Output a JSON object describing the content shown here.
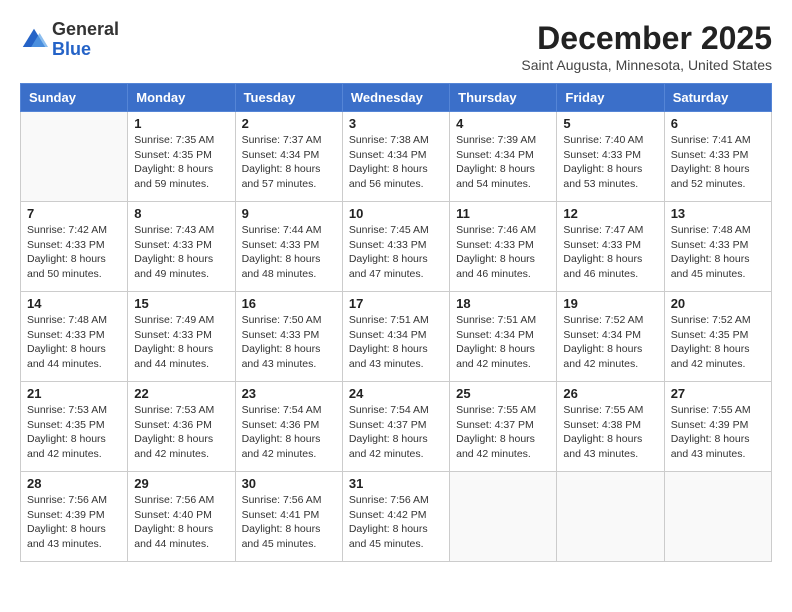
{
  "logo": {
    "general": "General",
    "blue": "Blue"
  },
  "title": "December 2025",
  "location": "Saint Augusta, Minnesota, United States",
  "days_header": [
    "Sunday",
    "Monday",
    "Tuesday",
    "Wednesday",
    "Thursday",
    "Friday",
    "Saturday"
  ],
  "weeks": [
    [
      {
        "day": "",
        "info": ""
      },
      {
        "day": "1",
        "info": "Sunrise: 7:35 AM\nSunset: 4:35 PM\nDaylight: 8 hours\nand 59 minutes."
      },
      {
        "day": "2",
        "info": "Sunrise: 7:37 AM\nSunset: 4:34 PM\nDaylight: 8 hours\nand 57 minutes."
      },
      {
        "day": "3",
        "info": "Sunrise: 7:38 AM\nSunset: 4:34 PM\nDaylight: 8 hours\nand 56 minutes."
      },
      {
        "day": "4",
        "info": "Sunrise: 7:39 AM\nSunset: 4:34 PM\nDaylight: 8 hours\nand 54 minutes."
      },
      {
        "day": "5",
        "info": "Sunrise: 7:40 AM\nSunset: 4:33 PM\nDaylight: 8 hours\nand 53 minutes."
      },
      {
        "day": "6",
        "info": "Sunrise: 7:41 AM\nSunset: 4:33 PM\nDaylight: 8 hours\nand 52 minutes."
      }
    ],
    [
      {
        "day": "7",
        "info": "Sunrise: 7:42 AM\nSunset: 4:33 PM\nDaylight: 8 hours\nand 50 minutes."
      },
      {
        "day": "8",
        "info": "Sunrise: 7:43 AM\nSunset: 4:33 PM\nDaylight: 8 hours\nand 49 minutes."
      },
      {
        "day": "9",
        "info": "Sunrise: 7:44 AM\nSunset: 4:33 PM\nDaylight: 8 hours\nand 48 minutes."
      },
      {
        "day": "10",
        "info": "Sunrise: 7:45 AM\nSunset: 4:33 PM\nDaylight: 8 hours\nand 47 minutes."
      },
      {
        "day": "11",
        "info": "Sunrise: 7:46 AM\nSunset: 4:33 PM\nDaylight: 8 hours\nand 46 minutes."
      },
      {
        "day": "12",
        "info": "Sunrise: 7:47 AM\nSunset: 4:33 PM\nDaylight: 8 hours\nand 46 minutes."
      },
      {
        "day": "13",
        "info": "Sunrise: 7:48 AM\nSunset: 4:33 PM\nDaylight: 8 hours\nand 45 minutes."
      }
    ],
    [
      {
        "day": "14",
        "info": "Sunrise: 7:48 AM\nSunset: 4:33 PM\nDaylight: 8 hours\nand 44 minutes."
      },
      {
        "day": "15",
        "info": "Sunrise: 7:49 AM\nSunset: 4:33 PM\nDaylight: 8 hours\nand 44 minutes."
      },
      {
        "day": "16",
        "info": "Sunrise: 7:50 AM\nSunset: 4:33 PM\nDaylight: 8 hours\nand 43 minutes."
      },
      {
        "day": "17",
        "info": "Sunrise: 7:51 AM\nSunset: 4:34 PM\nDaylight: 8 hours\nand 43 minutes."
      },
      {
        "day": "18",
        "info": "Sunrise: 7:51 AM\nSunset: 4:34 PM\nDaylight: 8 hours\nand 42 minutes."
      },
      {
        "day": "19",
        "info": "Sunrise: 7:52 AM\nSunset: 4:34 PM\nDaylight: 8 hours\nand 42 minutes."
      },
      {
        "day": "20",
        "info": "Sunrise: 7:52 AM\nSunset: 4:35 PM\nDaylight: 8 hours\nand 42 minutes."
      }
    ],
    [
      {
        "day": "21",
        "info": "Sunrise: 7:53 AM\nSunset: 4:35 PM\nDaylight: 8 hours\nand 42 minutes."
      },
      {
        "day": "22",
        "info": "Sunrise: 7:53 AM\nSunset: 4:36 PM\nDaylight: 8 hours\nand 42 minutes."
      },
      {
        "day": "23",
        "info": "Sunrise: 7:54 AM\nSunset: 4:36 PM\nDaylight: 8 hours\nand 42 minutes."
      },
      {
        "day": "24",
        "info": "Sunrise: 7:54 AM\nSunset: 4:37 PM\nDaylight: 8 hours\nand 42 minutes."
      },
      {
        "day": "25",
        "info": "Sunrise: 7:55 AM\nSunset: 4:37 PM\nDaylight: 8 hours\nand 42 minutes."
      },
      {
        "day": "26",
        "info": "Sunrise: 7:55 AM\nSunset: 4:38 PM\nDaylight: 8 hours\nand 43 minutes."
      },
      {
        "day": "27",
        "info": "Sunrise: 7:55 AM\nSunset: 4:39 PM\nDaylight: 8 hours\nand 43 minutes."
      }
    ],
    [
      {
        "day": "28",
        "info": "Sunrise: 7:56 AM\nSunset: 4:39 PM\nDaylight: 8 hours\nand 43 minutes."
      },
      {
        "day": "29",
        "info": "Sunrise: 7:56 AM\nSunset: 4:40 PM\nDaylight: 8 hours\nand 44 minutes."
      },
      {
        "day": "30",
        "info": "Sunrise: 7:56 AM\nSunset: 4:41 PM\nDaylight: 8 hours\nand 45 minutes."
      },
      {
        "day": "31",
        "info": "Sunrise: 7:56 AM\nSunset: 4:42 PM\nDaylight: 8 hours\nand 45 minutes."
      },
      {
        "day": "",
        "info": ""
      },
      {
        "day": "",
        "info": ""
      },
      {
        "day": "",
        "info": ""
      }
    ]
  ]
}
